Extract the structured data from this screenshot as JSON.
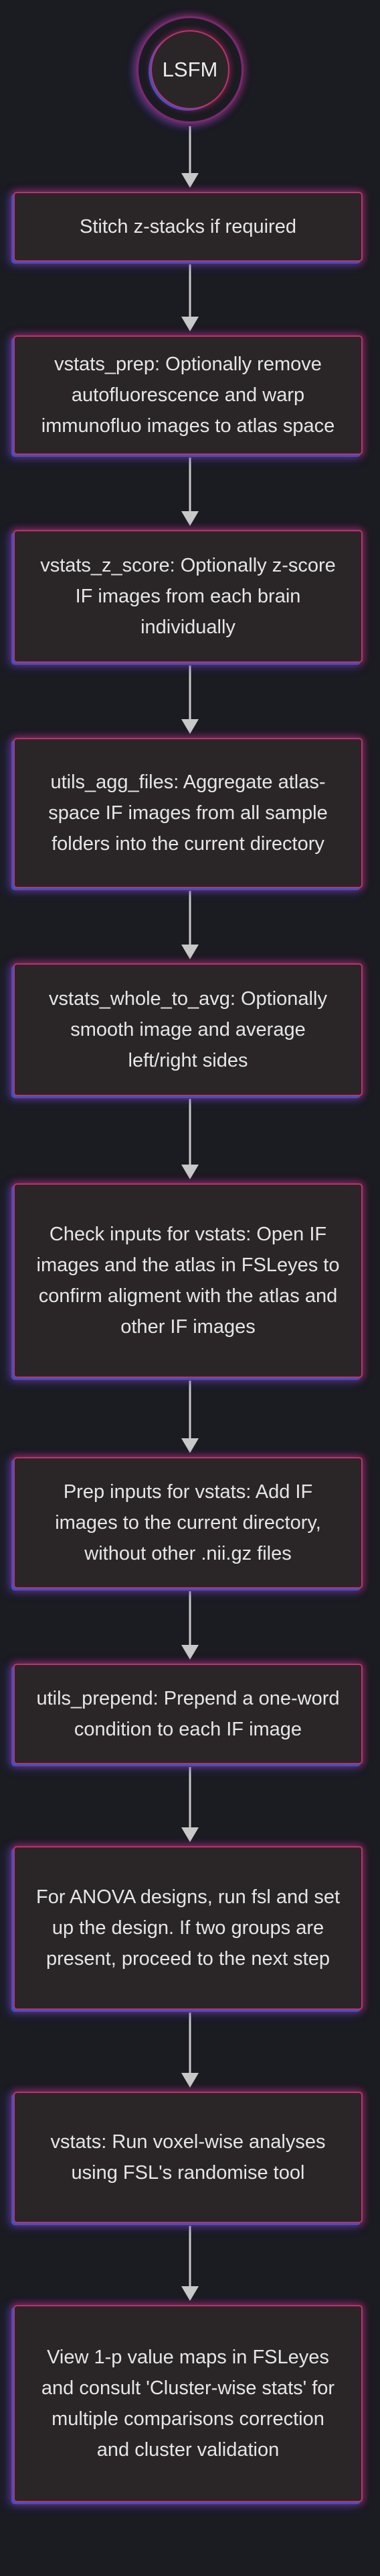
{
  "diagram": {
    "start_label": "LSFM",
    "steps": [
      "Stitch z-stacks if required",
      "vstats_prep: Optionally remove autofluorescence and warp immunofluo images to atlas space",
      "vstats_z_score: Optionally z-score IF images from each brain individually",
      "utils_agg_files: Aggregate atlas-space IF images from all sample folders into the current directory",
      "vstats_whole_to_avg: Optionally smooth image and average left/right sides",
      "Check inputs for vstats: Open IF images and the atlas in FSLeyes to confirm aligment with the atlas and other IF images",
      "Prep inputs for vstats: Add IF images to the current directory, without other .nii.gz files",
      "utils_prepend: Prepend a one-word condition to each IF image",
      "For ANOVA designs, run fsl and set up the design. If two groups are present, proceed to the next step",
      "vstats: Run voxel-wise analyses using FSL's randomise tool",
      "View 1-p value maps in FSLeyes and consult 'Cluster-wise stats' for multiple comparisons correction and cluster validation"
    ],
    "colors": {
      "background": "#1b1b22",
      "node_fill": "#2a2628",
      "border_pink": "#c0306a",
      "border_blue": "#3b52c8",
      "arrow": "#c8c8c8",
      "text": "#e6e6e6"
    }
  }
}
